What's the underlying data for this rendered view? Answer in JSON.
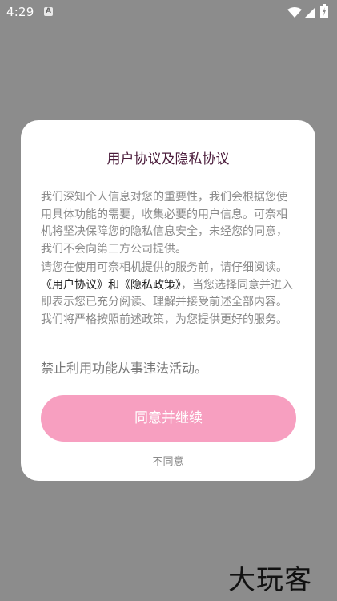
{
  "status_bar": {
    "time": "4:29",
    "notification_icon": "A",
    "icons": [
      "wifi-icon",
      "signal-icon",
      "battery-icon"
    ]
  },
  "dialog": {
    "title": "用户协议及隐私协议",
    "paragraph1": "我们深知个人信息对您的重要性，我们会根据您使用具体功能的需要，收集必要的用户信息。可奈相机将坚决保障您的隐私信息安全，未经您的同意，我们不会向第三方公司提供。",
    "paragraph2_prefix": "请您在使用可奈相机提供的服务前，请仔细阅读。",
    "user_agreement_link": "《用户协议》",
    "and_text": "和",
    "privacy_policy_link": "《隐私政策》",
    "paragraph2_suffix": "，当您选择同意并进入即表示您已充分阅读、理解并接受前述全部内容。我们将严格按照前述政策，为您提供更好的服务。",
    "warning": "禁止利用功能从事违法活动。",
    "agree_button": "同意并继续",
    "disagree_link": "不同意"
  },
  "watermark": "大玩客",
  "colors": {
    "overlay": "#8c8c8c",
    "accent_button": "#f79fc0",
    "title": "#4a1b3a"
  }
}
